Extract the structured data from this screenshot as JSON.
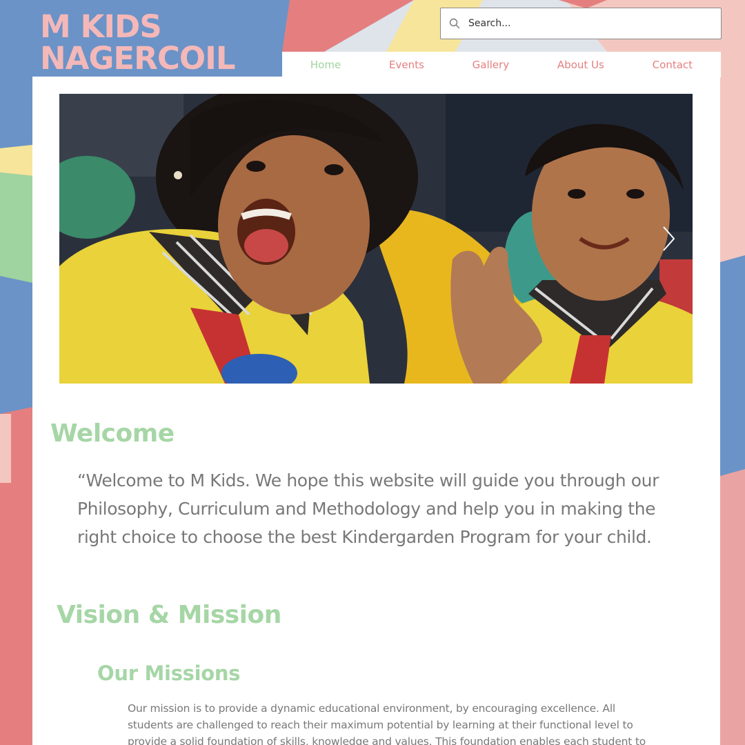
{
  "brand": {
    "line1": "M KIDS",
    "line2": "NAGERCOIL",
    "color": "#f4b8b8"
  },
  "search": {
    "placeholder": "Search..."
  },
  "nav": {
    "items": [
      {
        "label": "Home",
        "active": true
      },
      {
        "label": "Events"
      },
      {
        "label": "Gallery"
      },
      {
        "label": "About Us"
      },
      {
        "label": "Contact"
      }
    ],
    "active_color": "#9fd39f",
    "color": "#e57f7f"
  },
  "welcome": {
    "heading": "Welcome",
    "text": "“Welcome to M Kids. We hope this website will guide you through our Philosophy, Curriculum and Methodology and help you in making the right choice to choose the best Kindergarden Program for your child."
  },
  "vision": {
    "heading": "Vision & Mission",
    "missions_heading": "Our Missions",
    "missions_text": "Our mission is to provide a dynamic educational environment, by encouraging excellence. All students are challenged to reach their maximum potential by learning at their functional level to provide a solid foundation of skills, knowledge and values. This foundation enables each student to become a well-"
  },
  "colors": {
    "heading_green": "#a6d6a6",
    "body_gray": "#787878"
  }
}
